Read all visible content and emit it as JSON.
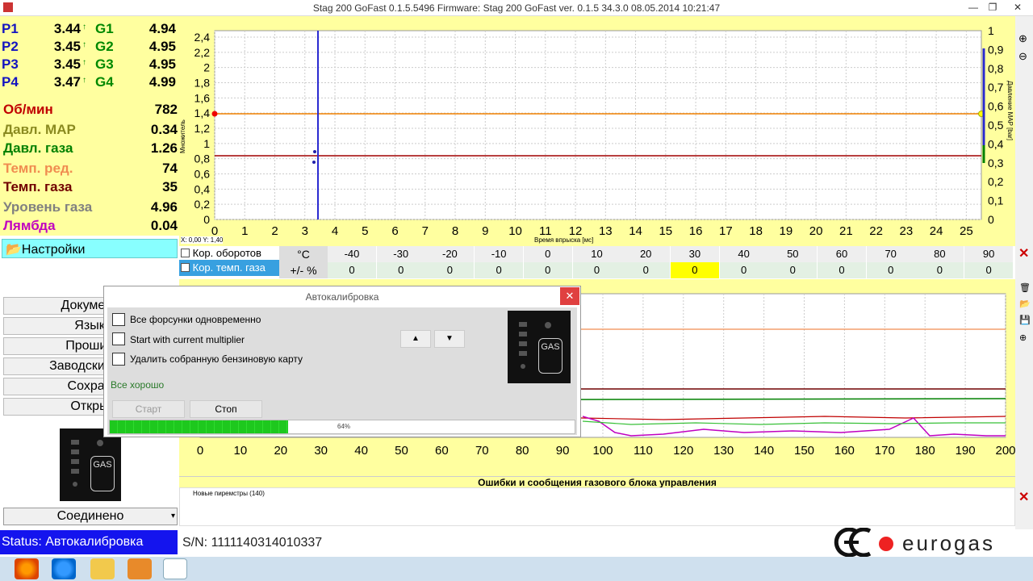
{
  "window": {
    "title": "Stag 200 GoFast 0.1.5.5496 Firmware: Stag 200 GoFast  ver. 0.1.5  34.3.0   08.05.2014  10:21:47"
  },
  "injectors": [
    {
      "p_label": "P1",
      "p_val": "3.44",
      "g_label": "G1",
      "g_val": "4.94"
    },
    {
      "p_label": "P2",
      "p_val": "3.45",
      "g_label": "G2",
      "g_val": "4.95"
    },
    {
      "p_label": "P3",
      "p_val": "3.45",
      "g_label": "G3",
      "g_val": "4.95"
    },
    {
      "p_label": "P4",
      "p_val": "3.47",
      "g_label": "G4",
      "g_val": "4.99"
    }
  ],
  "params": [
    {
      "label": "Об/мин",
      "value": "782",
      "color": "#c00000"
    },
    {
      "label": "Давл. MAP",
      "value": "0.34",
      "color": "#8a8a20"
    },
    {
      "label": "Давл. газа",
      "value": "1.26",
      "color": "#008000"
    },
    {
      "label": "Темп. ред.",
      "value": "74",
      "color": "#f08c50"
    },
    {
      "label": "Темп. газа",
      "value": "35",
      "color": "#700000"
    },
    {
      "label": "Уровень газа",
      "value": "4.96",
      "color": "#808080"
    },
    {
      "label": "Лямбда",
      "value": "0.04",
      "color": "#c000c0"
    }
  ],
  "menu": {
    "settings": "Настройки",
    "items": [
      "Документ",
      "Язык",
      "Прошив",
      "Заводские на",
      "Сохран",
      "Откры"
    ],
    "connected": "Соединено"
  },
  "status": {
    "text": "Status: Автокалибровка",
    "serial": "S/N: 1111140314010337",
    "brand": "eurogas"
  },
  "chart1": {
    "left_axis_label": "Множитель",
    "right_axis_label": "Давление MAP [bar]",
    "x_label": "Время впрыска [мс]",
    "coords": "X: 0,00  Y: 1,40",
    "left_ticks": [
      "2,4",
      "2,2",
      "2",
      "1,8",
      "1,6",
      "1,4",
      "1,2",
      "1",
      "0,8",
      "0,6",
      "0,4",
      "0,2",
      "0"
    ],
    "right_ticks": [
      "1",
      "0,9",
      "0,8",
      "0,7",
      "0,6",
      "0,5",
      "0,4",
      "0,3",
      "0,2",
      "0,1",
      "0"
    ],
    "x_ticks": [
      "0",
      "1",
      "2",
      "3",
      "4",
      "5",
      "6",
      "7",
      "8",
      "9",
      "10",
      "11",
      "12",
      "13",
      "14",
      "15",
      "16",
      "17",
      "18",
      "19",
      "20",
      "21",
      "22",
      "23",
      "24",
      "25"
    ]
  },
  "corr_table": {
    "row1_label": "Кор. оборотов",
    "row2_label": "Кор. темп. газа",
    "unit": "°C",
    "pct": "+/- %",
    "temps": [
      "-40",
      "-30",
      "-20",
      "-10",
      "0",
      "10",
      "20",
      "30",
      "40",
      "50",
      "60",
      "70",
      "80",
      "90"
    ],
    "values": [
      "0",
      "0",
      "0",
      "0",
      "0",
      "0",
      "0",
      "0",
      "0",
      "0",
      "0",
      "0",
      "0",
      "0"
    ]
  },
  "chart2": {
    "x_ticks": [
      "0",
      "10",
      "20",
      "30",
      "40",
      "50",
      "60",
      "70",
      "80",
      "90",
      "100",
      "110",
      "120",
      "130",
      "140",
      "150",
      "160",
      "170",
      "180",
      "190",
      "200"
    ]
  },
  "errors": {
    "title": "Ошибки и сообщения газового блока управления",
    "item": "Новые пиремстры (140)"
  },
  "dialog": {
    "title": "Автокалибровка",
    "options": [
      "Все форсунки одновременно",
      "Start with current multiplier",
      "Удалить собранную бензиновую карту"
    ],
    "status": "Все хорошо",
    "start": "Старт",
    "stop": "Стоп",
    "progress": "64%",
    "progress_value": 0.64,
    "gas_label": "GAS"
  },
  "gas_label": "GAS"
}
